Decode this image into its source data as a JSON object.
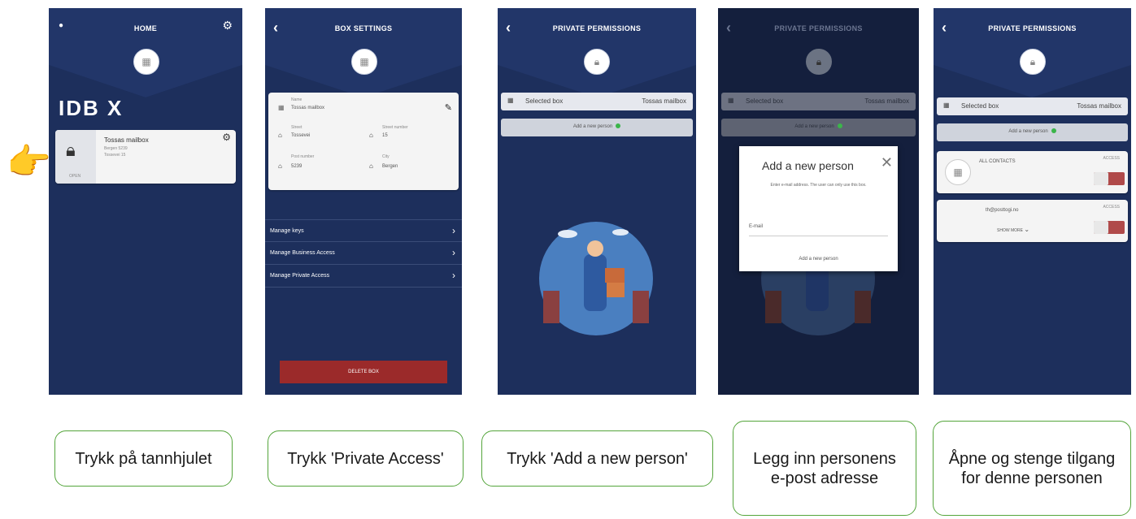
{
  "colors": {
    "phone_bg": "#1d2f5c",
    "accent_green": "#54a53b",
    "delete_red": "#9b2a2a",
    "caption_border": "#54a53b"
  },
  "screen1": {
    "title": "HOME",
    "brand": "IDB X",
    "card": {
      "name": "Tossas mailbox",
      "line1": "Bergen 5239",
      "line2": "Tossevei 15",
      "lock_label": "OPEN"
    }
  },
  "screen2": {
    "title": "BOX SETTINGS",
    "fields": {
      "name_label": "Name",
      "name_value": "Tossas mailbox",
      "street_label": "Street",
      "street_value": "Tossevei",
      "street_number_label": "Street number",
      "street_number_value": "15",
      "post_label": "Post number",
      "post_value": "5239",
      "city_label": "City",
      "city_value": "Bergen"
    },
    "menu": [
      "Manage keys",
      "Manage Business Access",
      "Manage Private Access"
    ],
    "delete_label": "DELETE BOX"
  },
  "screen3": {
    "title": "PRIVATE PERMISSIONS",
    "selected_label": "Selected box",
    "selected_value": "Tossas mailbox",
    "add_label": "Add a new person"
  },
  "screen4": {
    "title": "PRIVATE PERMISSIONS",
    "selected_label": "Selected box",
    "selected_value": "Tossas mailbox",
    "add_label": "Add a new person",
    "modal": {
      "title": "Add a new person",
      "text": "Enter e-mail address. The user can only use this box.",
      "email_label": "E-mail",
      "button": "Add a new person"
    }
  },
  "screen5": {
    "title": "PRIVATE PERMISSIONS",
    "selected_label": "Selected box",
    "selected_value": "Tossas mailbox",
    "add_label": "Add a new person",
    "contacts_label": "ALL CONTACTS",
    "access_label": "ACCESS",
    "person_email": "th@posttogi.no",
    "show_more": "SHOW MORE"
  },
  "captions": [
    "Trykk på tannhjulet",
    "Trykk 'Private Access'",
    "Trykk 'Add a new person'",
    "Legg inn personens e-post adresse",
    "Åpne og stenge tilgang for denne personen"
  ]
}
